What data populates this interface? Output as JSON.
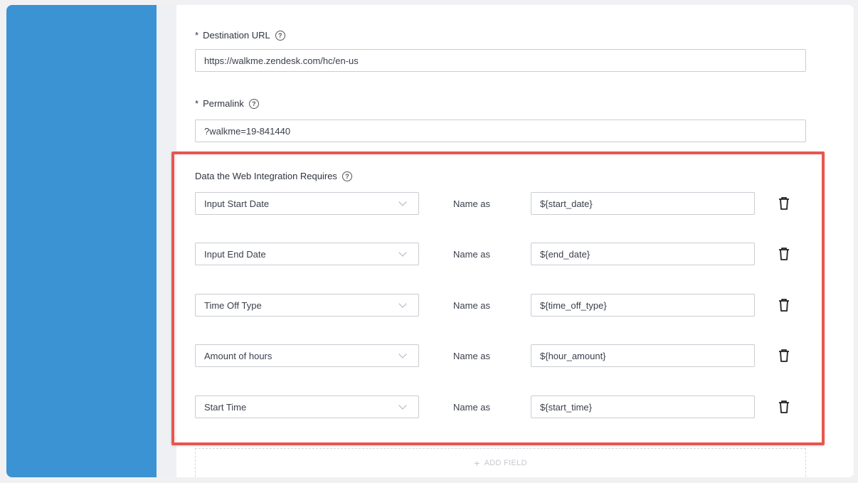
{
  "destination_url": {
    "label": "Destination URL",
    "required_mark": "*",
    "value": "https://walkme.zendesk.com/hc/en-us"
  },
  "permalink": {
    "label": "Permalink",
    "required_mark": "*",
    "value": "?walkme=19-841440"
  },
  "data_section": {
    "title": "Data the Web Integration Requires",
    "name_as_label": "Name as",
    "rows": [
      {
        "field": "Input Start Date",
        "variable": "${start_date}"
      },
      {
        "field": "Input End Date",
        "variable": "${end_date}"
      },
      {
        "field": "Time Off Type",
        "variable": "${time_off_type}"
      },
      {
        "field": "Amount of hours",
        "variable": "${hour_amount}"
      },
      {
        "field": "Start Time",
        "variable": "${start_time}"
      }
    ]
  },
  "add_field": {
    "icon": "plus-icon",
    "label": "ADD FIELD"
  },
  "colors": {
    "sidebar_blue": "#3b93d3",
    "highlight_red": "#e8564f"
  }
}
